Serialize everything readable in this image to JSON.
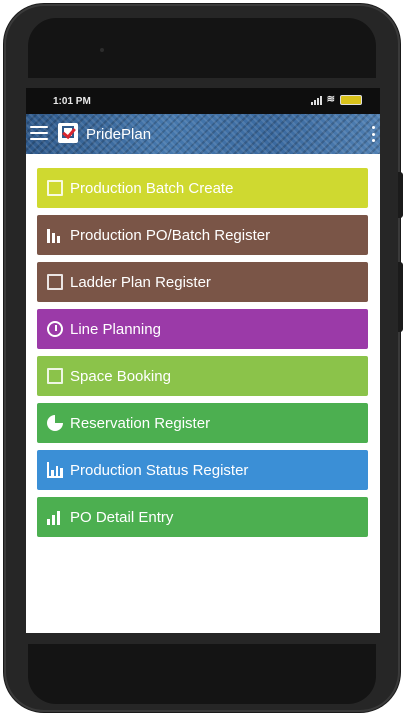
{
  "status_bar": {
    "time": "1:01 PM"
  },
  "app_bar": {
    "title": "PridePlan"
  },
  "menu": {
    "items": [
      {
        "label": "Production Batch Create",
        "color": "#cfd930",
        "icon": "calendar-grid-icon"
      },
      {
        "label": "Production PO/Batch Register",
        "color": "#7a5547",
        "icon": "bar-chart-icon"
      },
      {
        "label": "Ladder Plan Register",
        "color": "#7a5547",
        "icon": "keyboard-icon"
      },
      {
        "label": "Line Planning",
        "color": "#9b3aa8",
        "icon": "clock-icon"
      },
      {
        "label": "Space Booking",
        "color": "#8bc34a",
        "icon": "keyboard-icon"
      },
      {
        "label": "Reservation Register",
        "color": "#4caf50",
        "icon": "pie-chart-icon"
      },
      {
        "label": "Production Status Register",
        "color": "#3b8fd6",
        "icon": "bar-chart-icon"
      },
      {
        "label": "PO Detail Entry",
        "color": "#4caf50",
        "icon": "signal-bars-icon"
      }
    ]
  }
}
